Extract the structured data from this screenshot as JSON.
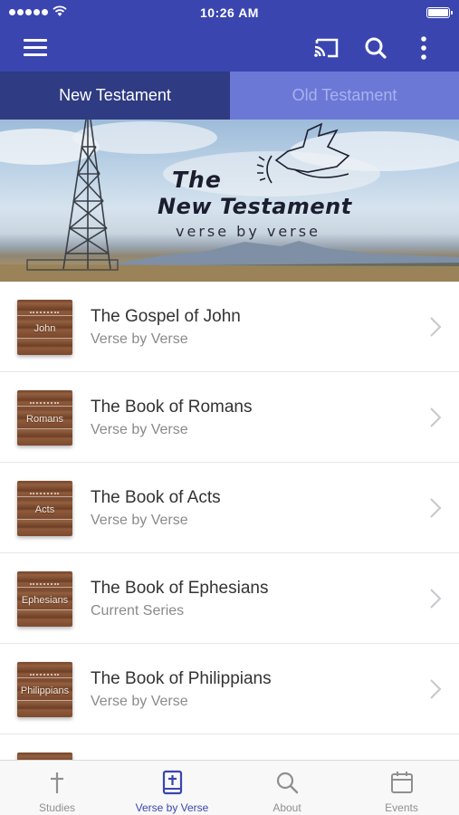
{
  "status_bar": {
    "time": "10:26 AM"
  },
  "app_bar": {
    "icons": [
      "menu-icon",
      "cast-icon",
      "search-icon",
      "more-vertical-icon"
    ],
    "color": "#3b45b0"
  },
  "tabs": [
    {
      "label": "New Testament",
      "active": true
    },
    {
      "label": "Old Testament",
      "active": false
    }
  ],
  "banner": {
    "line1": "The",
    "line2": "New Testament",
    "line3": "verse by verse"
  },
  "list": {
    "items": [
      {
        "thumb_label": "John",
        "title": "The Gospel of John",
        "subtitle": "Verse by Verse"
      },
      {
        "thumb_label": "Romans",
        "title": "The Book of Romans",
        "subtitle": "Verse by Verse"
      },
      {
        "thumb_label": "Acts",
        "title": "The Book of Acts",
        "subtitle": "Verse by Verse"
      },
      {
        "thumb_label": "Ephesians",
        "title": "The Book of Ephesians",
        "subtitle": "Current Series"
      },
      {
        "thumb_label": "Philippians",
        "title": "The Book of Philippians",
        "subtitle": "Verse by Verse"
      }
    ]
  },
  "bottom_nav": {
    "items": [
      {
        "label": "Studies",
        "icon": "cross-icon",
        "active": false
      },
      {
        "label": "Verse by Verse",
        "icon": "bible-icon",
        "active": true
      },
      {
        "label": "About",
        "icon": "search-icon",
        "active": false
      },
      {
        "label": "Events",
        "icon": "calendar-icon",
        "active": false
      }
    ],
    "active_color": "#3b45b0",
    "inactive_color": "#8f8f8f"
  }
}
